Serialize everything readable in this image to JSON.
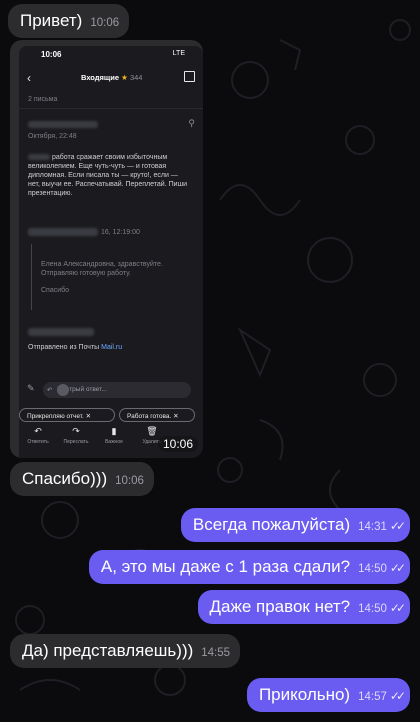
{
  "messages": [
    {
      "text": "Привет)",
      "time": "10:06",
      "side": "in"
    },
    {
      "text": "Спасибо)))",
      "time": "10:06",
      "side": "in"
    },
    {
      "text": "Всегда пожалуйста)",
      "time": "14:31",
      "side": "out"
    },
    {
      "text": "А, это мы даже с 1 раза сдали?",
      "time": "14:50",
      "side": "out"
    },
    {
      "text": "Даже правок нет?",
      "time": "14:50",
      "side": "out"
    },
    {
      "text": "Да) представляешь)))",
      "time": "14:55",
      "side": "in"
    },
    {
      "text": "Прикольно)",
      "time": "14:57",
      "side": "out"
    }
  ],
  "read_ticks": "✓✓",
  "screenshot": {
    "time_badge": "10:06",
    "status_time": "10:06",
    "status_net": "LTE",
    "nav": {
      "title": "Входящие",
      "star": "★",
      "count": "344"
    },
    "letters_count": "2 письма",
    "date1": "Октября, 22:48",
    "body_text": "работа сражает своим избыточным великолепием. Еще чуть-чуть — и готовая дипломная. Если писала ты — круто!, если — нет, выучи ее. Распечатывай. Переплетай. Пиши презентацию.",
    "date2": "16, 12:19:00",
    "quote_greeting": "Елена Александровна, здравствуйте.",
    "quote_line": "Отправляю готовую работу.",
    "quote_thanks": "Спасибо",
    "sent_from": "Отправлено из Почты ",
    "sent_link": "Mail.ru",
    "reply_placeholder": "Быстрый ответ...",
    "chips": [
      "Прикрепляю отчет.",
      "Работа готова."
    ],
    "toolbar": [
      {
        "icon": "reply-icon",
        "glyph": "↶",
        "label": "Ответить"
      },
      {
        "icon": "forward-icon",
        "glyph": "↷",
        "label": "Переслать"
      },
      {
        "icon": "bookmark-icon",
        "glyph": "▮",
        "label": "Важное"
      },
      {
        "icon": "trash-icon",
        "glyph": "🗑",
        "label": "Удалить"
      }
    ]
  },
  "colors": {
    "incoming": "#2c2c2f",
    "outgoing": "#6a5cf0",
    "background": "#0b0b0e"
  }
}
